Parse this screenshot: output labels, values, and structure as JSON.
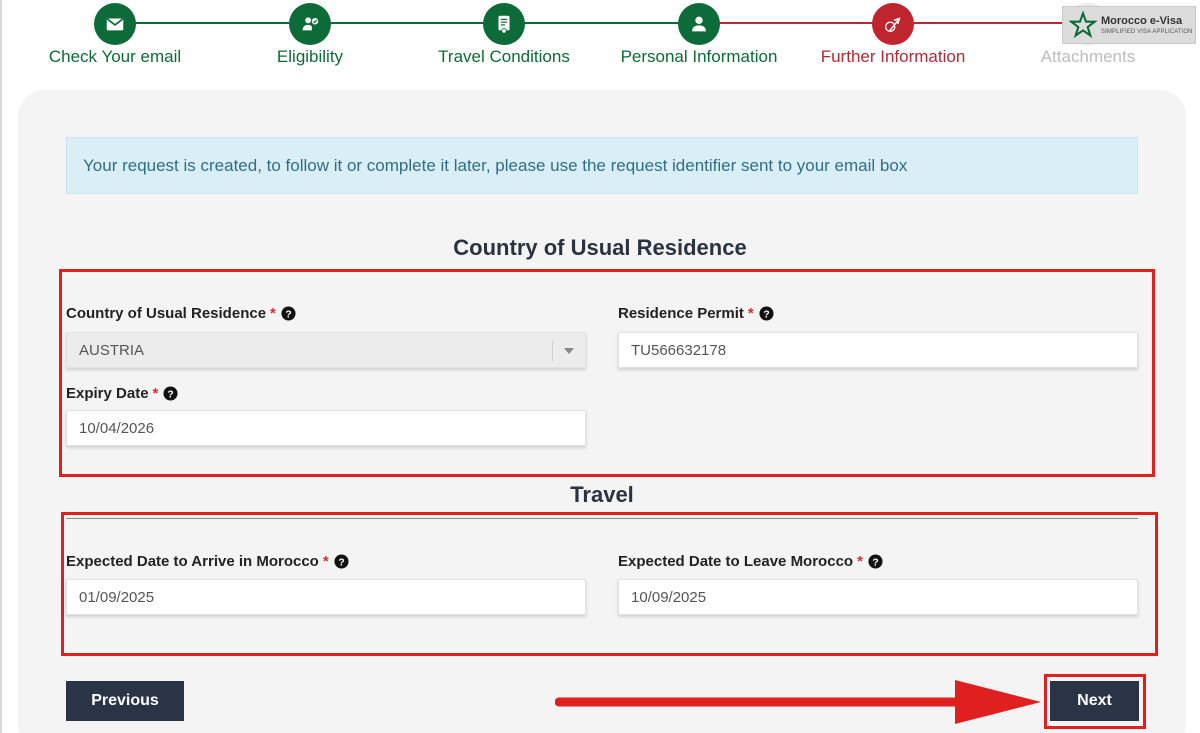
{
  "stepper": {
    "steps": [
      {
        "label": "Check Your email",
        "icon": "envelope-icon",
        "state": "done"
      },
      {
        "label": "Eligibility",
        "icon": "eligibility-icon",
        "state": "done"
      },
      {
        "label": "Travel Conditions",
        "icon": "document-icon",
        "state": "done"
      },
      {
        "label": "Personal Information",
        "icon": "user-icon",
        "state": "done"
      },
      {
        "label": "Further Information",
        "icon": "plane-icon",
        "state": "active"
      },
      {
        "label": "Attachments",
        "icon": "attachment-icon",
        "state": "todo"
      }
    ]
  },
  "brand": {
    "name": "Morocco e-Visa",
    "tagline": "SIMPLIFIED VISA APPLICATION"
  },
  "alert": {
    "message": "Your request is created, to follow it or complete it later, please use the request identifier sent to your email box"
  },
  "residence": {
    "title": "Country of Usual Residence",
    "country": {
      "label": "Country of Usual Residence",
      "value": "AUSTRIA"
    },
    "permit": {
      "label": "Residence Permit",
      "value": "TU566632178"
    },
    "expiry": {
      "label": "Expiry Date",
      "value": "10/04/2026"
    }
  },
  "travel": {
    "title": "Travel",
    "arrive": {
      "label": "Expected Date to Arrive in Morocco",
      "value": "01/09/2025"
    },
    "leave": {
      "label": "Expected Date to Leave Morocco",
      "value": "10/09/2025"
    }
  },
  "required_mark": "*",
  "buttons": {
    "previous": "Previous",
    "next": "Next"
  },
  "colors": {
    "done": "#0d6b3a",
    "active": "#c0252f",
    "highlight": "#e01f1f",
    "button": "#2a3447"
  }
}
